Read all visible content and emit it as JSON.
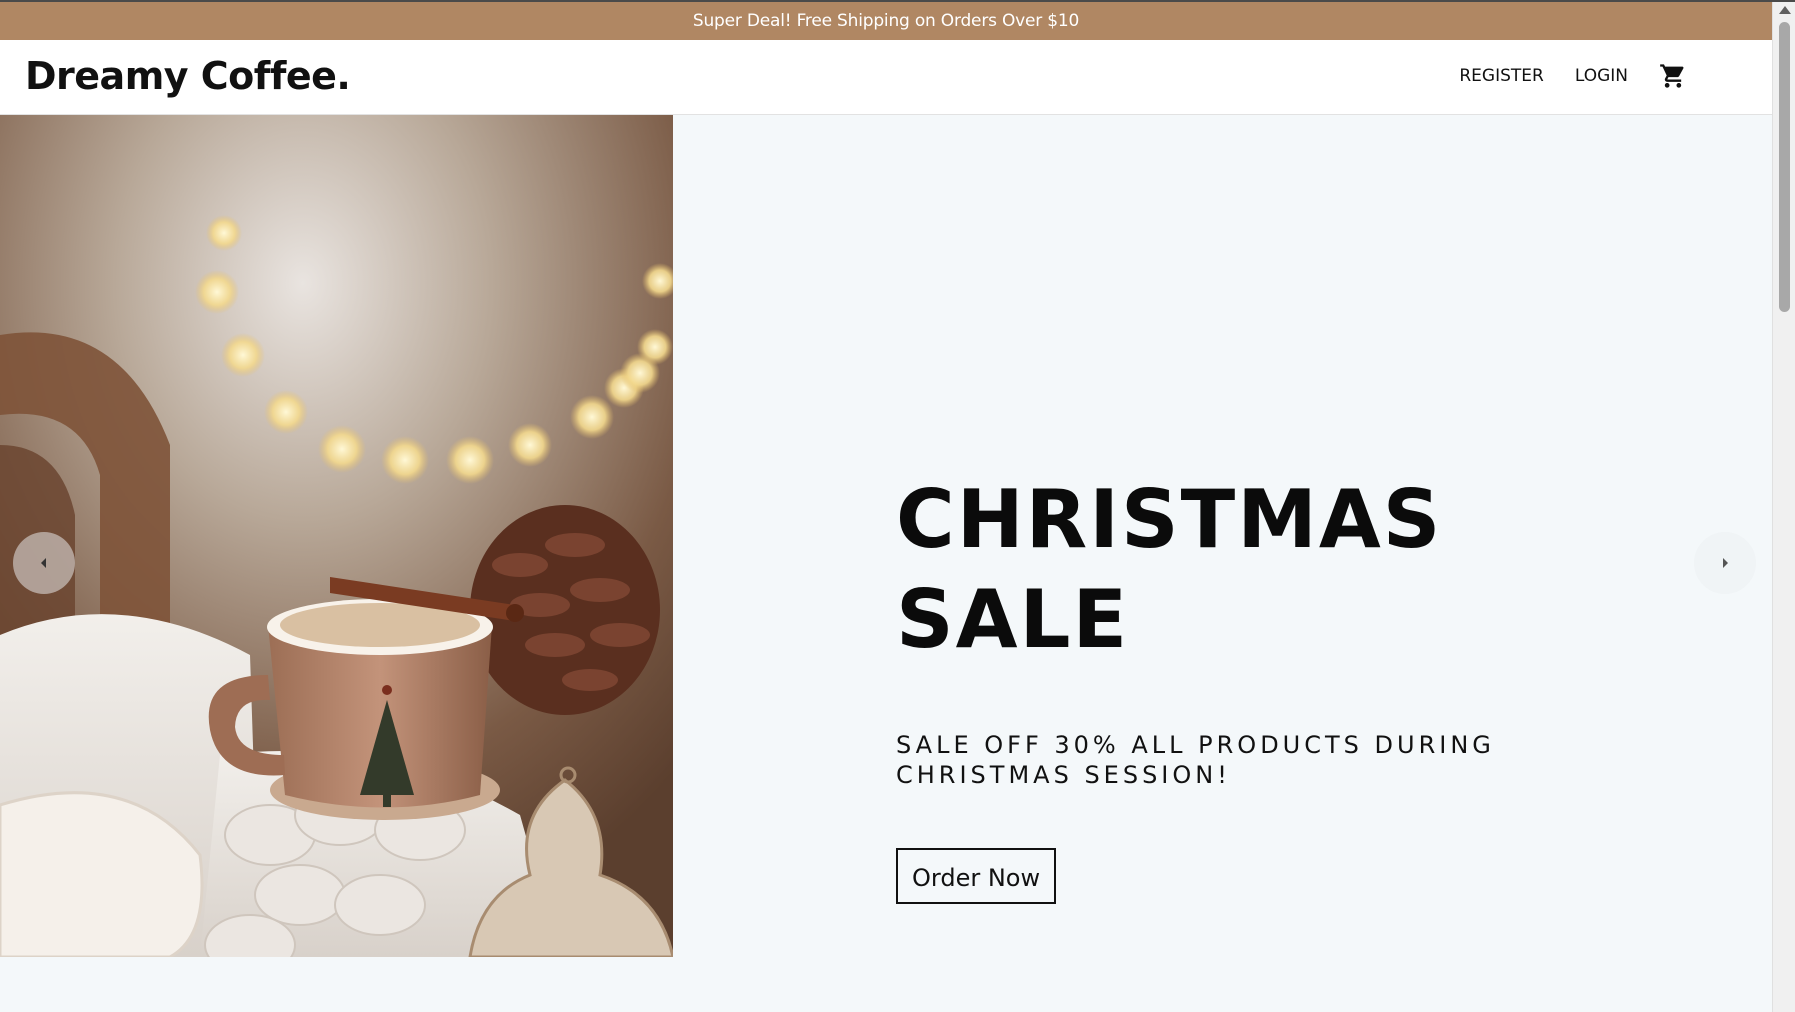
{
  "promo_bar": {
    "text": "Super Deal! Free Shipping on Orders Over $10"
  },
  "header": {
    "logo": "Dreamy Coffee.",
    "nav": {
      "register": "REGISTER",
      "login": "LOGIN"
    },
    "cart_icon": "shopping-cart-icon"
  },
  "hero": {
    "image_alt": "Christmas coffee mug with cinnamon stick, pine cones and knit blanket",
    "title": "CHRISTMAS SALE",
    "subtitle": "SALE OFF 30% ALL PRODUCTS DURING CHRISTMAS SESSION!",
    "cta_label": "Order Now",
    "prev_icon": "chevron-left-icon",
    "next_icon": "chevron-right-icon"
  },
  "colors": {
    "promo_bg": "#b08763",
    "page_bg": "#f4f8fa",
    "text": "#111111"
  }
}
